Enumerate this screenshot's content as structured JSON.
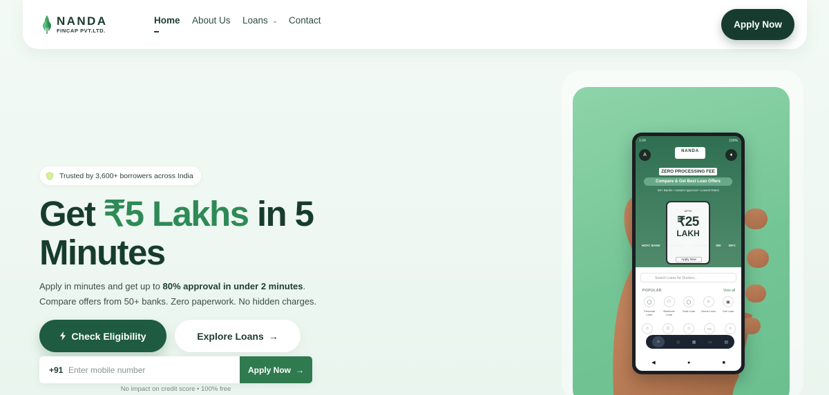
{
  "brand": {
    "name": "NANDA",
    "sub": "FINCAP PVT.LTD."
  },
  "nav": {
    "home": "Home",
    "about": "About Us",
    "loans": "Loans",
    "contact": "Contact",
    "apply_label": "Apply Now"
  },
  "hero": {
    "badge": "Trusted by 3,600+ borrowers across India",
    "title_prefix": "Get ",
    "title_highlight": "₹5 Lakhs",
    "title_suffix": " in 5 Minutes",
    "sub_line1_start": "Apply in minutes and get up to ",
    "sub_line1_bold": "80% approval in under 2 minutes",
    "sub_line1_end": ".",
    "sub_line2": "Compare offers from 50+ banks. Zero paperwork. No hidden charges.",
    "check_label": "Check Eligibility",
    "explore_label": "Explore Loans",
    "phone_prefix": "+91",
    "phone_placeholder": "Enter mobile number",
    "form_apply_label": "Apply Now",
    "form_note": "No impact on credit score • 100% free"
  },
  "phone": {
    "time": "1:04",
    "battery": "100%",
    "avatar": "A",
    "logo": "NANDA",
    "zero_fee": "ZERO PROCESSING FEE",
    "compare": "Compare & Get Best Loan Offers",
    "features": "50+ Banks • Instant Approval • Lowest Rates",
    "upto": "UPTO",
    "amount": "₹25",
    "lakh": "LAKH",
    "apply": "Apply Now",
    "banks": [
      "HDFC BANK",
      "ICICI Bank",
      "AXIS BANK",
      "SBI",
      "IDFC"
    ],
    "search": "Search Loans for Doctors...",
    "popular": "POPULAR",
    "view_all": "View all",
    "categories": [
      "Personal Loan",
      "Business Loan",
      "Gold Loan",
      "Home Loan",
      "Car Loan"
    ],
    "tabs": [
      "Home"
    ]
  },
  "colors": {
    "primary_dark": "#173c2f",
    "accent_green": "#2e8a56",
    "button_green": "#1e5b40",
    "phone_bg": "#74c596"
  }
}
